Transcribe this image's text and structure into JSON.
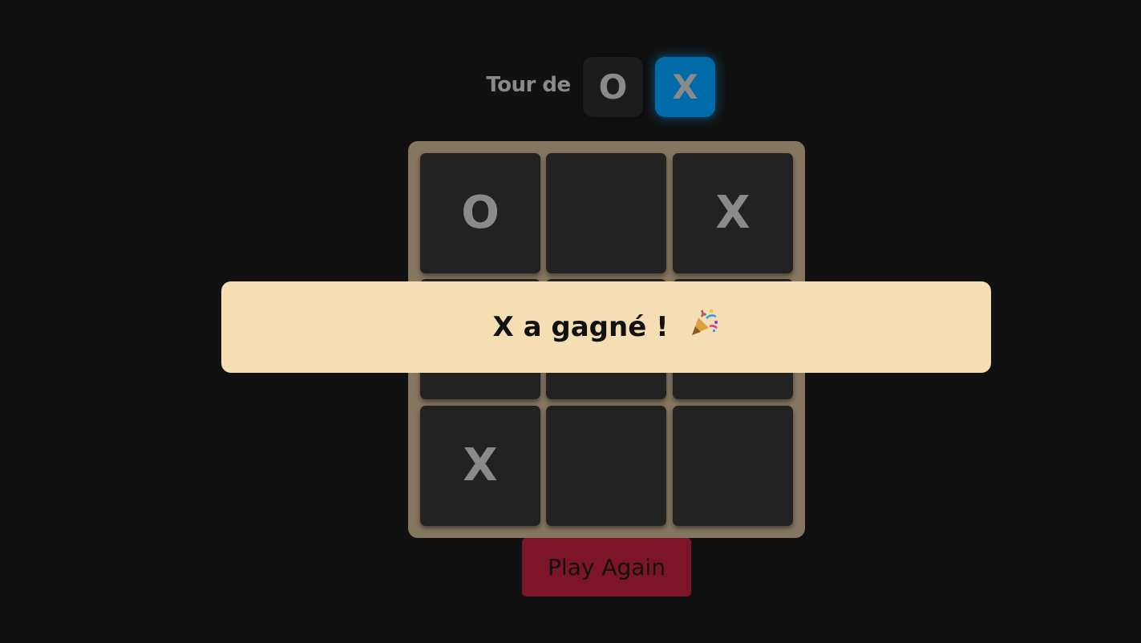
{
  "turn": {
    "label": "Tour de",
    "players": [
      "O",
      "X"
    ],
    "active": "X"
  },
  "board": {
    "cells": [
      "O",
      "",
      "X",
      "",
      "",
      "",
      "X",
      "",
      ""
    ]
  },
  "banner": {
    "message": "X a gagné !",
    "icon": "party-popper-icon"
  },
  "actions": {
    "play_again_label": "Play Again"
  },
  "colors": {
    "background": "#111111",
    "board_frame": "#857660",
    "cell": "#222222",
    "active_player": "#006ba8",
    "banner": "#f5deb3",
    "play_again": "#7d1529"
  }
}
